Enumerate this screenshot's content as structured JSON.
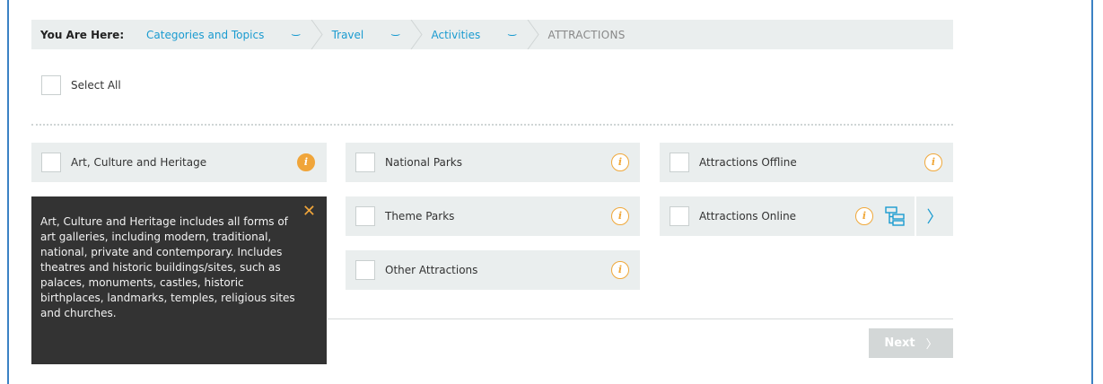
{
  "breadcrumb": {
    "here_label": "You Are Here:",
    "items": [
      {
        "label": "Categories and Topics"
      },
      {
        "label": "Travel"
      },
      {
        "label": "Activities"
      }
    ],
    "current": "ATTRACTIONS"
  },
  "select_all": {
    "label": "Select All"
  },
  "options": [
    {
      "label": "Art, Culture and Heritage"
    },
    {
      "label": "National Parks"
    },
    {
      "label": "Attractions Offline"
    },
    {
      "label": "Theme Parks"
    },
    {
      "label": "Attractions Online"
    },
    {
      "label": "Other Attractions"
    }
  ],
  "info_glyph": "i",
  "tooltip": {
    "text": "Art, Culture and Heritage includes all forms of art galleries, including modern, traditional, national, private and contemporary. Includes theatres and historic buildings/sites, such as palaces, monuments, castles, historic birthplaces, landmarks, temples, religious sites and churches.",
    "close_glyph": "✕"
  },
  "next_button": {
    "label": "Next",
    "arrow": "〉"
  },
  "more_arrow": "〉",
  "colors": {
    "accent": "#1a9bd0",
    "info": "#f0a53a",
    "tile_bg": "#eaeeee",
    "tooltip_bg": "#333333"
  }
}
